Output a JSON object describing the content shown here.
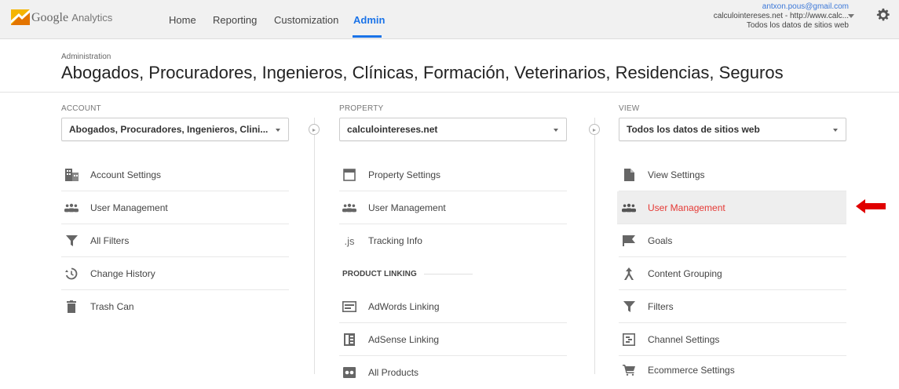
{
  "topbar": {
    "brand_google": "Google",
    "brand_analytics": "Analytics",
    "nav": [
      "Home",
      "Reporting",
      "Customization",
      "Admin"
    ],
    "active_nav": "Admin",
    "account_email": "antxon.pous@gmail.com",
    "account_property": "calculointereses.net - http://www.calc...",
    "account_view": "Todos los datos de sitios web",
    "icons": {
      "logo": "analytics-logo-icon",
      "settings": "gear-icon",
      "account_menu": "chevron-down-icon"
    },
    "colors": {
      "active": "#1a73e8",
      "logo_orange": "#f4b400",
      "logo_dark": "#e37400"
    }
  },
  "header": {
    "breadcrumb": "Administration",
    "title": "Abogados, Procuradores, Ingenieros, Clínicas, Formación, Veterinarios, Residencias, Seguros"
  },
  "account": {
    "label": "ACCOUNT",
    "selected": "Abogados, Procuradores, Ingenieros, Clini...",
    "items": [
      {
        "label": "Account Settings",
        "icon": "building-icon"
      },
      {
        "label": "User Management",
        "icon": "users-icon"
      },
      {
        "label": "All Filters",
        "icon": "filter-icon"
      },
      {
        "label": "Change History",
        "icon": "history-icon"
      },
      {
        "label": "Trash Can",
        "icon": "trash-icon"
      }
    ]
  },
  "property": {
    "label": "PROPERTY",
    "selected": "calculointereses.net",
    "items": [
      {
        "label": "Property Settings",
        "icon": "property-icon"
      },
      {
        "label": "User Management",
        "icon": "users-icon"
      },
      {
        "label": "Tracking Info",
        "icon": "js-icon",
        "glyph": ".js"
      }
    ],
    "product_linking": "PRODUCT LINKING",
    "linking_items": [
      {
        "label": "AdWords Linking",
        "icon": "adwords-icon"
      },
      {
        "label": "AdSense Linking",
        "icon": "adsense-icon"
      },
      {
        "label": "All Products",
        "icon": "all-products-icon"
      }
    ]
  },
  "view": {
    "label": "VIEW",
    "selected": "Todos los datos de sitios web",
    "items": [
      {
        "label": "View Settings",
        "icon": "document-icon"
      },
      {
        "label": "User Management",
        "icon": "users-icon",
        "highlighted": true
      },
      {
        "label": "Goals",
        "icon": "flag-icon"
      },
      {
        "label": "Content Grouping",
        "icon": "content-grouping-icon"
      },
      {
        "label": "Filters",
        "icon": "filter-icon"
      },
      {
        "label": "Channel Settings",
        "icon": "channel-icon"
      },
      {
        "label": "Ecommerce Settings",
        "icon": "cart-icon"
      }
    ],
    "highlight_color": "#e53935"
  },
  "annotation": {
    "icon": "red-arrow-icon",
    "color": "#e00000"
  }
}
